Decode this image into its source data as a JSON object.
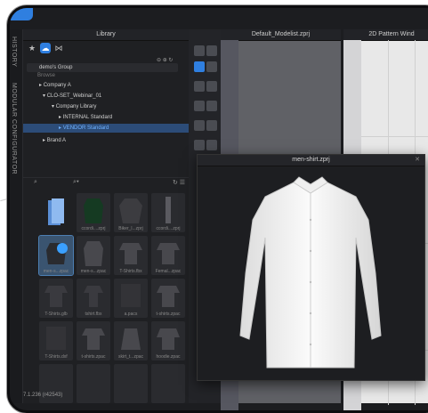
{
  "side_tabs": [
    "HISTORY",
    "MODULAR CONFIGURATOR"
  ],
  "panels": {
    "library": "Library",
    "modelist": "Default_Modelist.zprj",
    "pattern": "2D Pattern Wind"
  },
  "tree": {
    "group": "demo's Group",
    "browse": "Browse",
    "rows": [
      {
        "label": "Company A",
        "indent": 1
      },
      {
        "label": "CLO-SET_Webinar_01",
        "indent": 1
      },
      {
        "label": "Company Library",
        "indent": 2
      },
      {
        "label": "INTERNAL Standard",
        "indent": 3
      },
      {
        "label": "VENDOR Standard",
        "indent": 3,
        "selected": true
      },
      {
        "label": "Brand A",
        "indent": 1
      }
    ]
  },
  "thumbnails": [
    [
      "",
      "ccordi....zprj",
      "Biker_l...zprj",
      "ccordi....zprj"
    ],
    [
      "men-s...zpac",
      "men-s...zpac",
      "T-Shirts.fbx",
      "Femal...zpac"
    ],
    [
      "T-Shirts.glb",
      "tshirt.fbx",
      "a.pacs",
      "t-shirts.zpac"
    ],
    [
      "T-Shirts.dxf",
      "t-shirts.zpac",
      "skirt_t...zpac",
      "hoodie.zpac"
    ],
    [
      "",
      "",
      "",
      ""
    ]
  ],
  "floating_window": {
    "title": "men-shirt.zprj"
  },
  "status": "7.1.236 (r42543)",
  "colors": {
    "accent": "#2f7fe0",
    "selected": "#6fb1ff",
    "shirt": "#f4f4f4"
  }
}
